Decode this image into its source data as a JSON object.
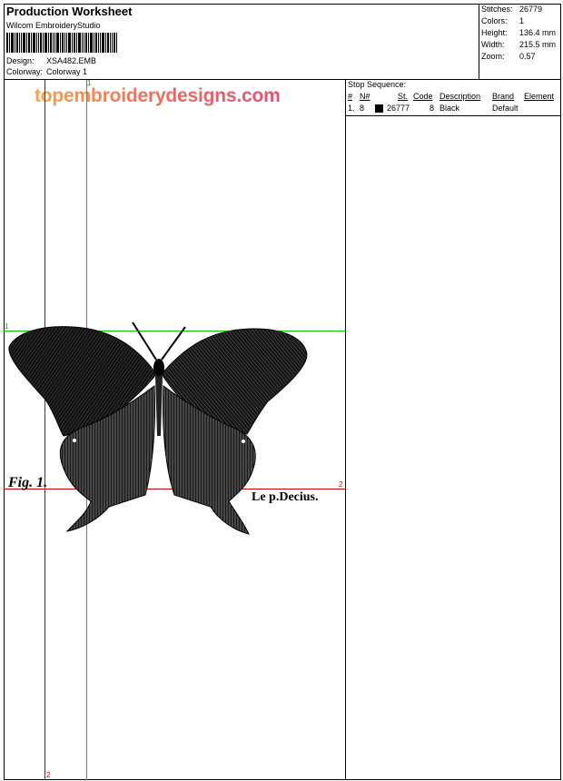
{
  "header": {
    "title": "Production Worksheet",
    "app_name": "Wilcom EmbroideryStudio",
    "design_label": "Design:",
    "design_value": "XSA482.EMB",
    "colorway_label": "Colorway:",
    "colorway_value": "Colorway 1"
  },
  "stats": {
    "stitches_label": "Stitches:",
    "stitches_value": "26779",
    "colors_label": "Colors:",
    "colors_value": "1",
    "height_label": "Height:",
    "height_value": "136.4 mm",
    "width_label": "Width:",
    "width_value": "215.5 mm",
    "zoom_label": "Zoom:",
    "zoom_value": "0.57"
  },
  "canvas": {
    "watermark": "topembroiderydesigns.com",
    "guide_labels": {
      "green_top": "1",
      "green_left": "1",
      "red_right": "2",
      "red_bottom": "2"
    },
    "figure_caption_left": "Fig. 1.",
    "figure_caption_right": "Le p.Decius.",
    "guide_green_color": "#00cc00",
    "guide_red_color": "#cc0000"
  },
  "stop_sequence": {
    "title": "Stop Sequence:",
    "columns": [
      "#",
      "N#",
      "St.",
      "Code",
      "Description",
      "Brand",
      "Element"
    ],
    "rows": [
      {
        "index": "1.",
        "n": "8",
        "color": "#000000",
        "stitches": "26777",
        "code": "8",
        "description": "Black",
        "brand": "Default",
        "element": ""
      }
    ]
  }
}
